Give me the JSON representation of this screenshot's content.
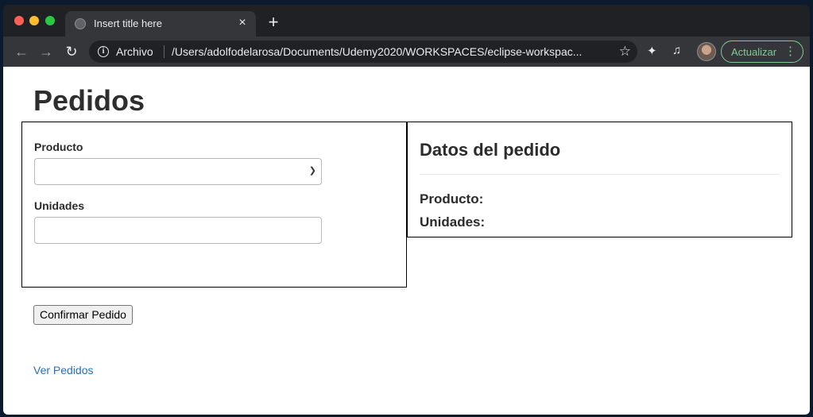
{
  "browser": {
    "tab_title": "Insert title here",
    "tab_close": "×",
    "new_tab": "+",
    "omnibox": {
      "security_label": "Archivo",
      "url": "/Users/adolfodelarosa/Documents/Udemy2020/WORKSPACES/eclipse-workspac..."
    },
    "update_button": "Actualizar"
  },
  "page": {
    "title": "Pedidos",
    "form": {
      "producto_label": "Producto",
      "producto_value": "",
      "unidades_label": "Unidades",
      "unidades_value": ""
    },
    "summary": {
      "title": "Datos del pedido",
      "producto_label": "Producto:",
      "unidades_label": "Unidades:"
    },
    "confirm_button": "Confirmar Pedido",
    "link": "Ver Pedidos"
  },
  "colors": {
    "link": "#2a6fb5",
    "update_accent": "#81c995"
  }
}
